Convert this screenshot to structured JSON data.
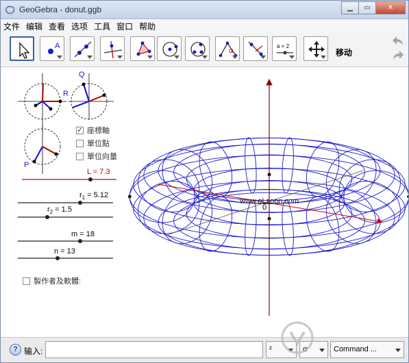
{
  "window": {
    "title": "GeoGebra - donut.ggb"
  },
  "menu": [
    "文件",
    "编辑",
    "查看",
    "选项",
    "工具",
    "窗口",
    "帮助"
  ],
  "toolbar": {
    "tools": [
      "move-tool",
      "point-tool",
      "line-tool",
      "perpendicular-tool",
      "polygon-tool",
      "circle-tool",
      "conic-tool",
      "angle-tool",
      "reflect-tool",
      "slider-tool",
      "move-view-tool"
    ],
    "slider_icon_text": "a = 2",
    "current_tool_label": "移动"
  },
  "left": {
    "circle_labels": {
      "q": "Q",
      "r": "R",
      "p": "P"
    },
    "checkboxes": [
      {
        "label": "座標軸",
        "checked": true
      },
      {
        "label": "單位點",
        "checked": false
      },
      {
        "label": "單位向量",
        "checked": false
      }
    ],
    "sliders": {
      "L": {
        "label": "L = 7.3",
        "value": 7.3,
        "min": 0,
        "max": 10
      },
      "r1": {
        "label": "r",
        "sub": "1",
        "suffix": " = 5.12",
        "value": 5.12
      },
      "r2": {
        "label": "r",
        "sub": "2",
        "suffix": " = 1.5",
        "value": 1.5
      },
      "m": {
        "label": "m = 18",
        "value": 18
      },
      "n": {
        "label": "n = 13",
        "value": 13
      }
    },
    "author_checkbox": {
      "label": "製作者及軟體:",
      "checked": false
    }
  },
  "graphics": {
    "origin_label": "0",
    "watermark": "www.oLsoon.com"
  },
  "input_bar": {
    "label": "输入:",
    "value": "",
    "symbol_combo": "²",
    "greek_combo": "α",
    "command_combo": "Command ..."
  },
  "colors": {
    "accent": "#3a5fa6",
    "mesh": "#1a1acc",
    "axis": "#8b0000",
    "slider_red": "#c00000"
  }
}
